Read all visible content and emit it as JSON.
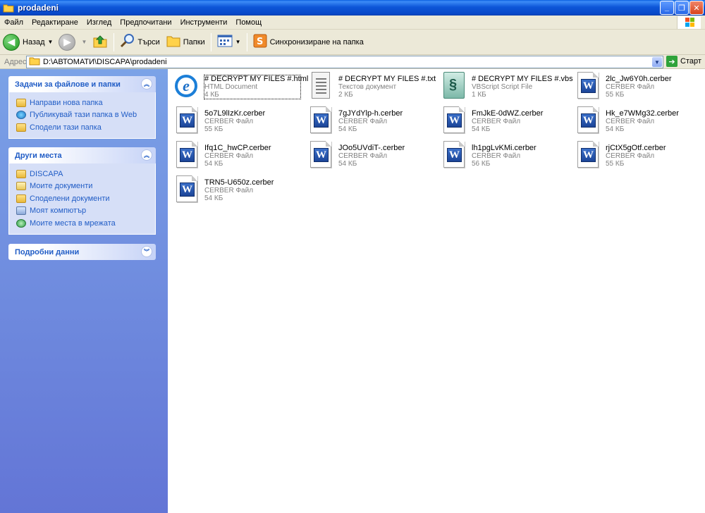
{
  "window": {
    "title": "prodadeni",
    "minimize": "_",
    "restore": "❐",
    "close": "✕"
  },
  "menu": [
    "Файл",
    "Редактиране",
    "Изглед",
    "Предпочитани",
    "Инструменти",
    "Помощ"
  ],
  "toolbar": {
    "back_label": "Назад",
    "search_label": "Търси",
    "folders_label": "Папки",
    "sync_label": "Синхронизиране на папка"
  },
  "address": {
    "label": "Адрес",
    "path": "D:\\АВТОМАТИ\\DISCAPA\\prodadeni",
    "go_label": "Старт"
  },
  "tasks_panel": {
    "title": "Задачи за файлове и папки",
    "items": [
      "Направи нова папка",
      "Публикувай тази папка в Web",
      "Сподели тази папка"
    ]
  },
  "places_panel": {
    "title": "Други места",
    "items": [
      "DISCAPA",
      "Моите документи",
      "Споделени документи",
      "Моят компютър",
      "Моите места в мрежата"
    ]
  },
  "details_panel": {
    "title": "Подробни данни"
  },
  "files": [
    {
      "name": "# DECRYPT MY FILES #.html",
      "type": "HTML Document",
      "size": "4 КБ",
      "icon": "ie-icon"
    },
    {
      "name": "# DECRYPT MY FILES #.txt",
      "type": "Текстов документ",
      "size": "2 КБ",
      "icon": "text-document-icon"
    },
    {
      "name": "# DECRYPT MY FILES #.vbs",
      "type": "VBScript Script File",
      "size": "1 КБ",
      "icon": "script-icon"
    },
    {
      "name": "2lc_Jw6Y0h.cerber",
      "type": "CERBER Файл",
      "size": "55 КБ",
      "icon": "word-icon"
    },
    {
      "name": "5o7L9lIzKr.cerber",
      "type": "CERBER Файл",
      "size": "55 КБ",
      "icon": "word-icon"
    },
    {
      "name": "7gJYdYlp-h.cerber",
      "type": "CERBER Файл",
      "size": "54 КБ",
      "icon": "word-icon"
    },
    {
      "name": "FmJkE-0dWZ.cerber",
      "type": "CERBER Файл",
      "size": "54 КБ",
      "icon": "word-icon"
    },
    {
      "name": "Hk_e7WMg32.cerber",
      "type": "CERBER Файл",
      "size": "54 КБ",
      "icon": "word-icon"
    },
    {
      "name": "Ifq1C_hwCP.cerber",
      "type": "CERBER Файл",
      "size": "54 КБ",
      "icon": "word-icon"
    },
    {
      "name": "JOo5UVdiT-.cerber",
      "type": "CERBER Файл",
      "size": "54 КБ",
      "icon": "word-icon"
    },
    {
      "name": "lh1pgLvKMi.cerber",
      "type": "CERBER Файл",
      "size": "56 КБ",
      "icon": "word-icon"
    },
    {
      "name": "rjCtX5gOtf.cerber",
      "type": "CERBER Файл",
      "size": "55 КБ",
      "icon": "word-icon"
    },
    {
      "name": "TRN5-U650z.cerber",
      "type": "CERBER Файл",
      "size": "54 КБ",
      "icon": "word-icon"
    }
  ]
}
